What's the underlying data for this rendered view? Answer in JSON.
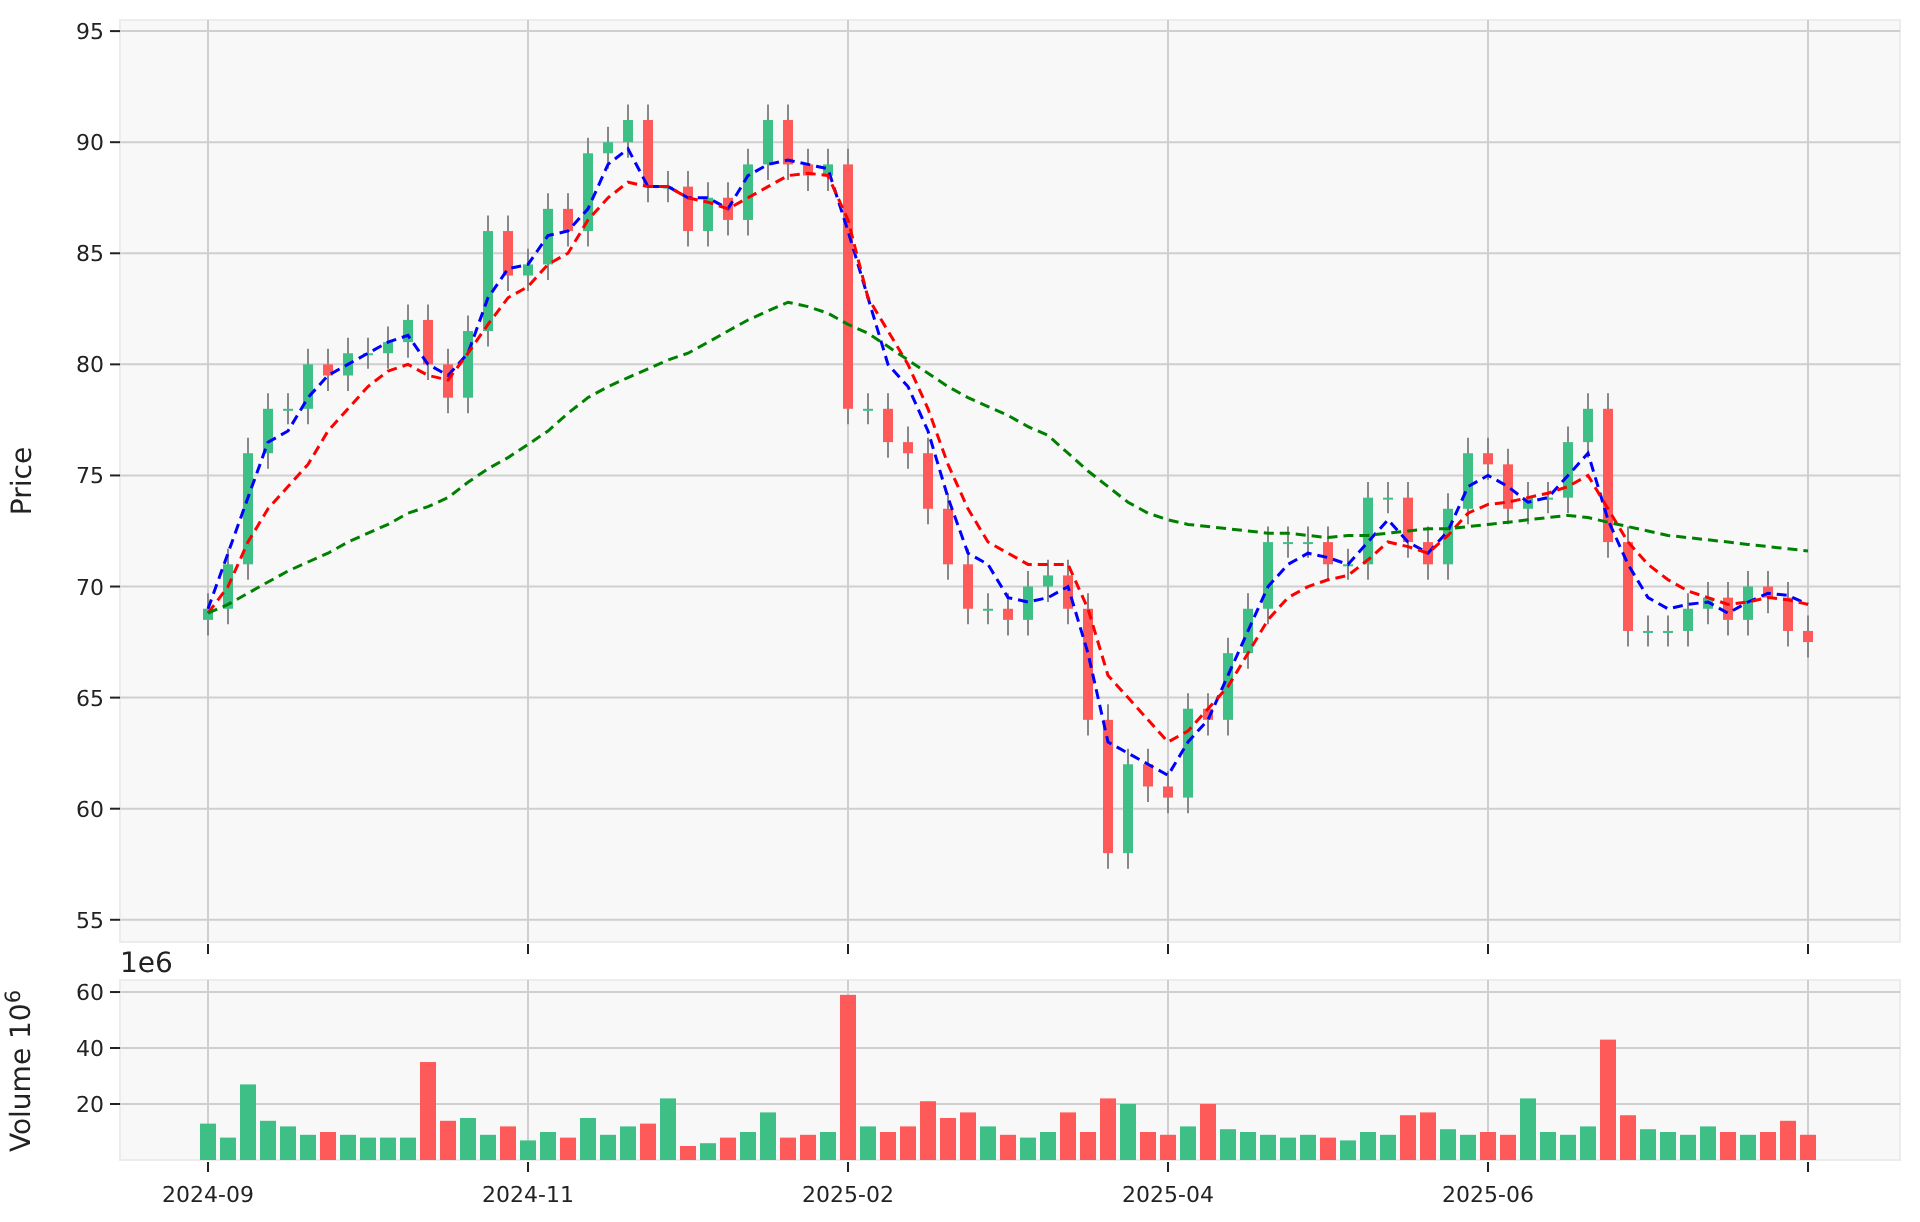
{
  "price_panel": {
    "chart_data": {
      "type": "candlestick",
      "ylabel": "Price",
      "categories": [
        null,
        null,
        null,
        null,
        null,
        null,
        null,
        null,
        null,
        null,
        null,
        null,
        null,
        null,
        null,
        null,
        null,
        null,
        null,
        null,
        null,
        null,
        null,
        null,
        null,
        null,
        null,
        null,
        null,
        null,
        null,
        null,
        null,
        null,
        null,
        null,
        null,
        null,
        null,
        null,
        null,
        null,
        null,
        null,
        null,
        null,
        null,
        null,
        null,
        null,
        null,
        null,
        null,
        null,
        null,
        null,
        null,
        null,
        null,
        null,
        null,
        null,
        null,
        null,
        null,
        null,
        null,
        null,
        null,
        null,
        null,
        null,
        null,
        null,
        null,
        null,
        null,
        null,
        null,
        null,
        null
      ],
      "ylim": [
        54,
        95.5
      ],
      "grid": true,
      "yticks": [
        55,
        60,
        65,
        70,
        75,
        80,
        85,
        90,
        95
      ],
      "ohlc": [
        [
          68.5,
          69.7,
          67.8,
          69
        ],
        [
          69,
          71.7,
          68.3,
          71
        ],
        [
          71,
          76.7,
          70.3,
          76
        ],
        [
          76,
          78.7,
          75.3,
          78
        ],
        [
          78,
          78.7,
          77.3,
          78
        ],
        [
          78,
          80.7,
          77.3,
          80
        ],
        [
          80,
          80.7,
          78.8,
          79.5
        ],
        [
          79.5,
          81.2,
          78.8,
          80.5
        ],
        [
          80.5,
          81.2,
          79.8,
          80.5
        ],
        [
          80.5,
          81.7,
          79.8,
          81
        ],
        [
          81,
          82.7,
          80.3,
          82
        ],
        [
          82,
          82.7,
          79.3,
          80
        ],
        [
          80,
          80.7,
          77.8,
          78.5
        ],
        [
          78.5,
          82.2,
          77.8,
          81.5
        ],
        [
          81.5,
          86.7,
          80.8,
          86
        ],
        [
          86,
          86.7,
          83.3,
          84
        ],
        [
          84,
          85.2,
          83.3,
          84.5
        ],
        [
          84.5,
          87.7,
          83.8,
          87
        ],
        [
          87,
          87.7,
          85.3,
          86
        ],
        [
          86,
          90.2,
          85.3,
          89.5
        ],
        [
          89.5,
          90.7,
          88.8,
          90
        ],
        [
          90,
          91.7,
          89.3,
          91
        ],
        [
          91,
          91.7,
          87.3,
          88
        ],
        [
          88,
          88.7,
          87.3,
          88
        ],
        [
          88,
          88.7,
          85.3,
          86
        ],
        [
          86,
          88.2,
          85.3,
          87.5
        ],
        [
          87.5,
          88.2,
          85.8,
          86.5
        ],
        [
          86.5,
          89.7,
          85.8,
          89
        ],
        [
          89,
          91.7,
          88.3,
          91
        ],
        [
          91,
          91.7,
          88.3,
          89
        ],
        [
          89,
          89.7,
          87.8,
          88.5
        ],
        [
          88.5,
          89.7,
          87.8,
          89
        ],
        [
          89,
          89.7,
          77.3,
          78
        ],
        [
          78,
          78.7,
          77.3,
          78
        ],
        [
          78,
          78.7,
          75.8,
          76.5
        ],
        [
          76.5,
          77.2,
          75.3,
          76
        ],
        [
          76,
          76.7,
          72.8,
          73.5
        ],
        [
          73.5,
          74.2,
          70.3,
          71
        ],
        [
          71,
          71.7,
          68.3,
          69
        ],
        [
          69,
          69.7,
          68.3,
          69
        ],
        [
          69,
          69.7,
          67.8,
          68.5
        ],
        [
          68.5,
          70.7,
          67.8,
          70
        ],
        [
          70,
          71.2,
          69.3,
          70.5
        ],
        [
          70.5,
          71.2,
          68.3,
          69
        ],
        [
          69,
          69.7,
          63.3,
          64
        ],
        [
          64,
          64.7,
          57.3,
          58
        ],
        [
          58,
          62.7,
          57.3,
          62
        ],
        [
          62,
          62.7,
          60.3,
          61
        ],
        [
          61,
          61.7,
          59.8,
          60.5
        ],
        [
          60.5,
          65.2,
          59.8,
          64.5
        ],
        [
          64.5,
          65.2,
          63.3,
          64
        ],
        [
          64,
          67.7,
          63.3,
          67
        ],
        [
          67,
          69.7,
          66.3,
          69
        ],
        [
          69,
          72.7,
          68.3,
          72
        ],
        [
          72,
          72.7,
          71.3,
          72
        ],
        [
          72,
          72.7,
          71.3,
          72
        ],
        [
          72,
          72.7,
          70.3,
          71
        ],
        [
          71,
          71.7,
          70.3,
          71
        ],
        [
          71,
          74.7,
          70.3,
          74
        ],
        [
          74,
          74.7,
          73.3,
          74
        ],
        [
          74,
          74.7,
          71.3,
          72
        ],
        [
          72,
          72.7,
          70.3,
          71
        ],
        [
          71,
          74.2,
          70.3,
          73.5
        ],
        [
          73.5,
          76.7,
          72.8,
          76
        ],
        [
          76,
          76.7,
          74.8,
          75.5
        ],
        [
          75.5,
          76.2,
          72.8,
          73.5
        ],
        [
          73.5,
          74.7,
          72.8,
          74
        ],
        [
          74,
          74.7,
          73.3,
          74
        ],
        [
          74,
          77.2,
          73.3,
          76.5
        ],
        [
          76.5,
          78.7,
          75.8,
          78
        ],
        [
          78,
          78.7,
          71.3,
          72
        ],
        [
          72,
          72.7,
          67.3,
          68
        ],
        [
          68,
          68.7,
          67.3,
          68
        ],
        [
          68,
          68.7,
          67.3,
          68
        ],
        [
          68,
          69.7,
          67.3,
          69
        ],
        [
          69,
          70.2,
          68.3,
          69.5
        ],
        [
          69.5,
          70.2,
          67.8,
          68.5
        ],
        [
          68.5,
          70.7,
          67.8,
          70
        ],
        [
          70,
          70.7,
          68.8,
          69.5
        ],
        [
          69.5,
          70.2,
          67.3,
          68
        ],
        [
          68,
          68.7,
          66.8,
          67.5
        ]
      ],
      "series": [
        {
          "type": "line",
          "line_style": "dashed",
          "color": "#0000ff",
          "values": [
            69,
            71.5,
            74,
            76.5,
            77,
            78.5,
            79.5,
            80,
            80.5,
            81,
            81.3,
            80,
            79.5,
            80.5,
            83,
            84.3,
            84.5,
            85.8,
            86,
            87,
            89,
            89.7,
            88,
            88,
            87.5,
            87.5,
            87,
            88.5,
            89,
            89.2,
            89,
            88.8,
            86,
            83,
            80,
            79,
            77,
            74,
            71.5,
            71,
            69.5,
            69.3,
            69.5,
            70,
            67,
            63,
            62.5,
            62,
            61.5,
            63,
            64,
            66,
            68,
            70,
            71,
            71.5,
            71.3,
            71,
            72,
            73,
            72,
            71.5,
            72.5,
            74.5,
            75,
            74.5,
            73.8,
            74,
            75,
            76,
            73,
            71,
            69.5,
            69,
            69.2,
            69.3,
            68.8,
            69.3,
            69.7,
            69.6,
            69.2
          ]
        },
        {
          "type": "line",
          "line_style": "dashed",
          "color": "#ff0000",
          "values": [
            68.8,
            70,
            72,
            73.5,
            74.5,
            75.5,
            77,
            78,
            79,
            79.7,
            80,
            79.5,
            79.3,
            80.5,
            81.8,
            83,
            83.5,
            84.5,
            85,
            86.5,
            87.5,
            88.2,
            88,
            88,
            87.5,
            87.3,
            87,
            87.5,
            88,
            88.5,
            88.6,
            88.5,
            86.5,
            83,
            81.5,
            80,
            78,
            75.5,
            73.5,
            72,
            71.5,
            71,
            71,
            71,
            69,
            66,
            65,
            64,
            63,
            63.5,
            64.5,
            65.5,
            67,
            68.5,
            69.5,
            70,
            70.3,
            70.5,
            71.2,
            72,
            71.8,
            71.5,
            72.3,
            73.3,
            73.7,
            73.8,
            74,
            74.2,
            74.5,
            75,
            73.5,
            72,
            71,
            70.3,
            69.8,
            69.5,
            69.2,
            69.3,
            69.5,
            69.4,
            69.2
          ]
        },
        {
          "type": "line",
          "line_style": "dashed",
          "color": "#008000",
          "values": [
            68.8,
            69.2,
            69.7,
            70.2,
            70.7,
            71.1,
            71.5,
            72,
            72.4,
            72.8,
            73.3,
            73.6,
            74,
            74.7,
            75.3,
            75.8,
            76.4,
            77,
            77.8,
            78.5,
            79,
            79.4,
            79.8,
            80.2,
            80.5,
            81,
            81.5,
            82,
            82.4,
            82.8,
            82.6,
            82.3,
            81.8,
            81.4,
            80.8,
            80.2,
            79.6,
            79,
            78.5,
            78.1,
            77.7,
            77.2,
            76.8,
            76,
            75.2,
            74.5,
            73.8,
            73.3,
            73,
            72.8,
            72.7,
            72.6,
            72.5,
            72.4,
            72.4,
            72.3,
            72.2,
            72.3,
            72.3,
            72.4,
            72.5,
            72.6,
            72.6,
            72.7,
            72.8,
            72.9,
            73,
            73.1,
            73.2,
            73.1,
            72.9,
            72.7,
            72.5,
            72.3,
            72.2,
            72.1,
            72,
            71.9,
            71.8,
            71.7,
            71.6
          ]
        }
      ]
    }
  },
  "volume_panel": {
    "offset_label": "1e6",
    "chart_data": {
      "type": "bar",
      "ylabel": "Volume  10$^{6}$",
      "categories": [
        "2024-09",
        null,
        null,
        null,
        null,
        null,
        null,
        null,
        null,
        null,
        null,
        null,
        null,
        null,
        null,
        null,
        "2024-11",
        null,
        null,
        null,
        null,
        null,
        null,
        null,
        null,
        null,
        null,
        null,
        null,
        null,
        null,
        null,
        "2025-02",
        null,
        null,
        null,
        null,
        null,
        null,
        null,
        null,
        null,
        null,
        null,
        null,
        null,
        null,
        null,
        "2025-04",
        null,
        null,
        null,
        null,
        null,
        null,
        null,
        null,
        null,
        null,
        null,
        null,
        null,
        null,
        null,
        "2025-06",
        null,
        null,
        null,
        null,
        null,
        null,
        null,
        null,
        null,
        null,
        null,
        null,
        null,
        null,
        null,
        null
      ],
      "ylim": [
        0,
        64.3
      ],
      "grid": true,
      "yticks": [
        20,
        40,
        60
      ],
      "series": [
        {
          "values": [
            13,
            8,
            27,
            14,
            12,
            9,
            10,
            9,
            8,
            8,
            8,
            35,
            14,
            15,
            9,
            12,
            7,
            10,
            8,
            15,
            9,
            12,
            13,
            22,
            5,
            6,
            8,
            10,
            17,
            8,
            9,
            10,
            59,
            12,
            10,
            12,
            21,
            15,
            17,
            12,
            9,
            8,
            10,
            17,
            10,
            22,
            20,
            10,
            9,
            12,
            20,
            11,
            10,
            9,
            8,
            9,
            8,
            7,
            10,
            9,
            16,
            17,
            11,
            9,
            10,
            9,
            22,
            10,
            9,
            12,
            43,
            16,
            11,
            10,
            9,
            12,
            10,
            9,
            10,
            14,
            9
          ]
        }
      ]
    }
  }
}
